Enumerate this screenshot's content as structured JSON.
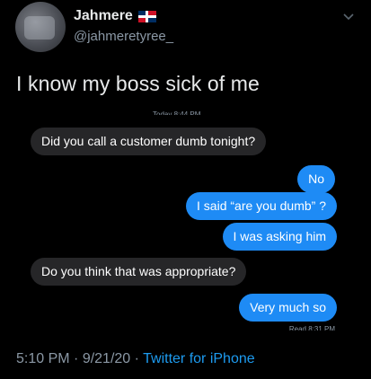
{
  "user": {
    "display_name": "Jahmere",
    "handle": "@jahmeretyree_",
    "flag_icon": "dominican-republic-flag-icon"
  },
  "tweet": {
    "text": "I know my boss sick of me",
    "time": "5:10 PM",
    "separator": " · ",
    "date": "9/21/20",
    "source": "Twitter for iPhone"
  },
  "screenshot": {
    "timestamp_partial": "Today 8:44 PM",
    "read_partial": "Read 8:31 PM",
    "messages": [
      {
        "direction": "incoming",
        "text": "Did you call a customer dumb tonight?"
      },
      {
        "direction": "outgoing",
        "text": "No"
      },
      {
        "direction": "outgoing",
        "text": "I said “are you dumb” ?"
      },
      {
        "direction": "outgoing",
        "text": "I was asking him"
      },
      {
        "direction": "incoming",
        "text": "Do you think that was appropriate?"
      },
      {
        "direction": "outgoing",
        "text": "Very much so"
      }
    ]
  },
  "colors": {
    "background": "#000000",
    "incoming_bubble": "#262628",
    "outgoing_bubble": "#1e8bf5",
    "link": "#1d9bf0"
  }
}
